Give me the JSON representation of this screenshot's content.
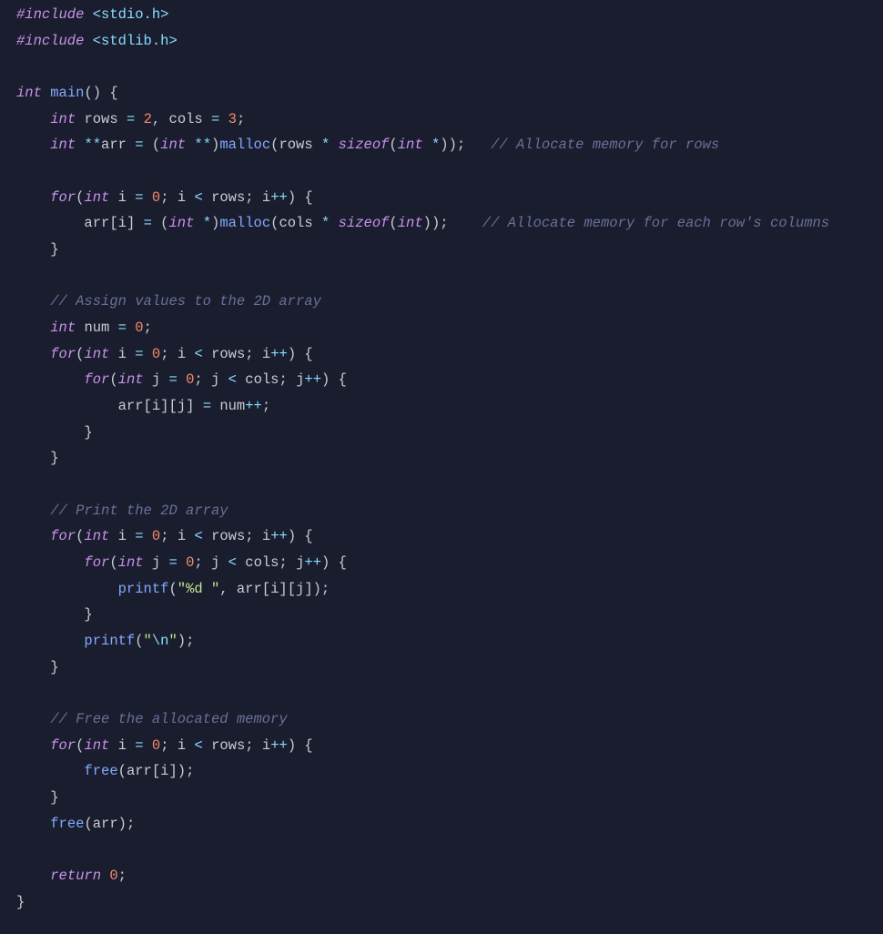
{
  "code": {
    "lines": [
      [
        {
          "c": "inc",
          "t": "#include"
        },
        {
          "c": "pun",
          "t": " "
        },
        {
          "c": "hdr",
          "t": "<stdio.h>"
        }
      ],
      [
        {
          "c": "inc",
          "t": "#include"
        },
        {
          "c": "pun",
          "t": " "
        },
        {
          "c": "hdr",
          "t": "<stdlib.h>"
        }
      ],
      [],
      [
        {
          "c": "type",
          "t": "int"
        },
        {
          "c": "pun",
          "t": " "
        },
        {
          "c": "fn",
          "t": "main"
        },
        {
          "c": "pun",
          "t": "() {"
        }
      ],
      [
        {
          "c": "pun",
          "t": "    "
        },
        {
          "c": "type",
          "t": "int"
        },
        {
          "c": "pun",
          "t": " "
        },
        {
          "c": "id",
          "t": "rows"
        },
        {
          "c": "pun",
          "t": " "
        },
        {
          "c": "op",
          "t": "="
        },
        {
          "c": "pun",
          "t": " "
        },
        {
          "c": "num",
          "t": "2"
        },
        {
          "c": "pun",
          "t": ", "
        },
        {
          "c": "id",
          "t": "cols"
        },
        {
          "c": "pun",
          "t": " "
        },
        {
          "c": "op",
          "t": "="
        },
        {
          "c": "pun",
          "t": " "
        },
        {
          "c": "num",
          "t": "3"
        },
        {
          "c": "pun",
          "t": ";"
        }
      ],
      [
        {
          "c": "pun",
          "t": "    "
        },
        {
          "c": "type",
          "t": "int"
        },
        {
          "c": "pun",
          "t": " "
        },
        {
          "c": "op",
          "t": "**"
        },
        {
          "c": "id",
          "t": "arr"
        },
        {
          "c": "pun",
          "t": " "
        },
        {
          "c": "op",
          "t": "="
        },
        {
          "c": "pun",
          "t": " ("
        },
        {
          "c": "type",
          "t": "int"
        },
        {
          "c": "pun",
          "t": " "
        },
        {
          "c": "op",
          "t": "**"
        },
        {
          "c": "pun",
          "t": ")"
        },
        {
          "c": "call",
          "t": "malloc"
        },
        {
          "c": "pun",
          "t": "("
        },
        {
          "c": "id",
          "t": "rows"
        },
        {
          "c": "pun",
          "t": " "
        },
        {
          "c": "op",
          "t": "*"
        },
        {
          "c": "pun",
          "t": " "
        },
        {
          "c": "kw",
          "t": "sizeof"
        },
        {
          "c": "pun",
          "t": "("
        },
        {
          "c": "type",
          "t": "int"
        },
        {
          "c": "pun",
          "t": " "
        },
        {
          "c": "op",
          "t": "*"
        },
        {
          "c": "pun",
          "t": "));   "
        },
        {
          "c": "cmt",
          "t": "// Allocate memory for rows"
        }
      ],
      [],
      [
        {
          "c": "pun",
          "t": "    "
        },
        {
          "c": "kw",
          "t": "for"
        },
        {
          "c": "pun",
          "t": "("
        },
        {
          "c": "type",
          "t": "int"
        },
        {
          "c": "pun",
          "t": " "
        },
        {
          "c": "id",
          "t": "i"
        },
        {
          "c": "pun",
          "t": " "
        },
        {
          "c": "op",
          "t": "="
        },
        {
          "c": "pun",
          "t": " "
        },
        {
          "c": "num",
          "t": "0"
        },
        {
          "c": "pun",
          "t": "; "
        },
        {
          "c": "id",
          "t": "i"
        },
        {
          "c": "pun",
          "t": " "
        },
        {
          "c": "op",
          "t": "<"
        },
        {
          "c": "pun",
          "t": " "
        },
        {
          "c": "id",
          "t": "rows"
        },
        {
          "c": "pun",
          "t": "; "
        },
        {
          "c": "id",
          "t": "i"
        },
        {
          "c": "op",
          "t": "++"
        },
        {
          "c": "pun",
          "t": ") {"
        }
      ],
      [
        {
          "c": "pun",
          "t": "        "
        },
        {
          "c": "id",
          "t": "arr"
        },
        {
          "c": "pun",
          "t": "["
        },
        {
          "c": "id",
          "t": "i"
        },
        {
          "c": "pun",
          "t": "] "
        },
        {
          "c": "op",
          "t": "="
        },
        {
          "c": "pun",
          "t": " ("
        },
        {
          "c": "type",
          "t": "int"
        },
        {
          "c": "pun",
          "t": " "
        },
        {
          "c": "op",
          "t": "*"
        },
        {
          "c": "pun",
          "t": ")"
        },
        {
          "c": "call",
          "t": "malloc"
        },
        {
          "c": "pun",
          "t": "("
        },
        {
          "c": "id",
          "t": "cols"
        },
        {
          "c": "pun",
          "t": " "
        },
        {
          "c": "op",
          "t": "*"
        },
        {
          "c": "pun",
          "t": " "
        },
        {
          "c": "kw",
          "t": "sizeof"
        },
        {
          "c": "pun",
          "t": "("
        },
        {
          "c": "type",
          "t": "int"
        },
        {
          "c": "pun",
          "t": "));    "
        },
        {
          "c": "cmt",
          "t": "// Allocate memory for each row's columns"
        }
      ],
      [
        {
          "c": "pun",
          "t": "    }"
        }
      ],
      [],
      [
        {
          "c": "pun",
          "t": "    "
        },
        {
          "c": "cmt",
          "t": "// Assign values to the 2D array"
        }
      ],
      [
        {
          "c": "pun",
          "t": "    "
        },
        {
          "c": "type",
          "t": "int"
        },
        {
          "c": "pun",
          "t": " "
        },
        {
          "c": "id",
          "t": "num"
        },
        {
          "c": "pun",
          "t": " "
        },
        {
          "c": "op",
          "t": "="
        },
        {
          "c": "pun",
          "t": " "
        },
        {
          "c": "num",
          "t": "0"
        },
        {
          "c": "pun",
          "t": ";"
        }
      ],
      [
        {
          "c": "pun",
          "t": "    "
        },
        {
          "c": "kw",
          "t": "for"
        },
        {
          "c": "pun",
          "t": "("
        },
        {
          "c": "type",
          "t": "int"
        },
        {
          "c": "pun",
          "t": " "
        },
        {
          "c": "id",
          "t": "i"
        },
        {
          "c": "pun",
          "t": " "
        },
        {
          "c": "op",
          "t": "="
        },
        {
          "c": "pun",
          "t": " "
        },
        {
          "c": "num",
          "t": "0"
        },
        {
          "c": "pun",
          "t": "; "
        },
        {
          "c": "id",
          "t": "i"
        },
        {
          "c": "pun",
          "t": " "
        },
        {
          "c": "op",
          "t": "<"
        },
        {
          "c": "pun",
          "t": " "
        },
        {
          "c": "id",
          "t": "rows"
        },
        {
          "c": "pun",
          "t": "; "
        },
        {
          "c": "id",
          "t": "i"
        },
        {
          "c": "op",
          "t": "++"
        },
        {
          "c": "pun",
          "t": ") {"
        }
      ],
      [
        {
          "c": "pun",
          "t": "        "
        },
        {
          "c": "kw",
          "t": "for"
        },
        {
          "c": "pun",
          "t": "("
        },
        {
          "c": "type",
          "t": "int"
        },
        {
          "c": "pun",
          "t": " "
        },
        {
          "c": "id",
          "t": "j"
        },
        {
          "c": "pun",
          "t": " "
        },
        {
          "c": "op",
          "t": "="
        },
        {
          "c": "pun",
          "t": " "
        },
        {
          "c": "num",
          "t": "0"
        },
        {
          "c": "pun",
          "t": "; "
        },
        {
          "c": "id",
          "t": "j"
        },
        {
          "c": "pun",
          "t": " "
        },
        {
          "c": "op",
          "t": "<"
        },
        {
          "c": "pun",
          "t": " "
        },
        {
          "c": "id",
          "t": "cols"
        },
        {
          "c": "pun",
          "t": "; "
        },
        {
          "c": "id",
          "t": "j"
        },
        {
          "c": "op",
          "t": "++"
        },
        {
          "c": "pun",
          "t": ") {"
        }
      ],
      [
        {
          "c": "pun",
          "t": "            "
        },
        {
          "c": "id",
          "t": "arr"
        },
        {
          "c": "pun",
          "t": "["
        },
        {
          "c": "id",
          "t": "i"
        },
        {
          "c": "pun",
          "t": "]["
        },
        {
          "c": "id",
          "t": "j"
        },
        {
          "c": "pun",
          "t": "] "
        },
        {
          "c": "op",
          "t": "="
        },
        {
          "c": "pun",
          "t": " "
        },
        {
          "c": "id",
          "t": "num"
        },
        {
          "c": "op",
          "t": "++"
        },
        {
          "c": "pun",
          "t": ";"
        }
      ],
      [
        {
          "c": "pun",
          "t": "        }"
        }
      ],
      [
        {
          "c": "pun",
          "t": "    }"
        }
      ],
      [],
      [
        {
          "c": "pun",
          "t": "    "
        },
        {
          "c": "cmt",
          "t": "// Print the 2D array"
        }
      ],
      [
        {
          "c": "pun",
          "t": "    "
        },
        {
          "c": "kw",
          "t": "for"
        },
        {
          "c": "pun",
          "t": "("
        },
        {
          "c": "type",
          "t": "int"
        },
        {
          "c": "pun",
          "t": " "
        },
        {
          "c": "id",
          "t": "i"
        },
        {
          "c": "pun",
          "t": " "
        },
        {
          "c": "op",
          "t": "="
        },
        {
          "c": "pun",
          "t": " "
        },
        {
          "c": "num",
          "t": "0"
        },
        {
          "c": "pun",
          "t": "; "
        },
        {
          "c": "id",
          "t": "i"
        },
        {
          "c": "pun",
          "t": " "
        },
        {
          "c": "op",
          "t": "<"
        },
        {
          "c": "pun",
          "t": " "
        },
        {
          "c": "id",
          "t": "rows"
        },
        {
          "c": "pun",
          "t": "; "
        },
        {
          "c": "id",
          "t": "i"
        },
        {
          "c": "op",
          "t": "++"
        },
        {
          "c": "pun",
          "t": ") {"
        }
      ],
      [
        {
          "c": "pun",
          "t": "        "
        },
        {
          "c": "kw",
          "t": "for"
        },
        {
          "c": "pun",
          "t": "("
        },
        {
          "c": "type",
          "t": "int"
        },
        {
          "c": "pun",
          "t": " "
        },
        {
          "c": "id",
          "t": "j"
        },
        {
          "c": "pun",
          "t": " "
        },
        {
          "c": "op",
          "t": "="
        },
        {
          "c": "pun",
          "t": " "
        },
        {
          "c": "num",
          "t": "0"
        },
        {
          "c": "pun",
          "t": "; "
        },
        {
          "c": "id",
          "t": "j"
        },
        {
          "c": "pun",
          "t": " "
        },
        {
          "c": "op",
          "t": "<"
        },
        {
          "c": "pun",
          "t": " "
        },
        {
          "c": "id",
          "t": "cols"
        },
        {
          "c": "pun",
          "t": "; "
        },
        {
          "c": "id",
          "t": "j"
        },
        {
          "c": "op",
          "t": "++"
        },
        {
          "c": "pun",
          "t": ") {"
        }
      ],
      [
        {
          "c": "pun",
          "t": "            "
        },
        {
          "c": "call",
          "t": "printf"
        },
        {
          "c": "pun",
          "t": "("
        },
        {
          "c": "str",
          "t": "\"%d \""
        },
        {
          "c": "pun",
          "t": ", "
        },
        {
          "c": "id",
          "t": "arr"
        },
        {
          "c": "pun",
          "t": "["
        },
        {
          "c": "id",
          "t": "i"
        },
        {
          "c": "pun",
          "t": "]["
        },
        {
          "c": "id",
          "t": "j"
        },
        {
          "c": "pun",
          "t": "]);"
        }
      ],
      [
        {
          "c": "pun",
          "t": "        }"
        }
      ],
      [
        {
          "c": "pun",
          "t": "        "
        },
        {
          "c": "call",
          "t": "printf"
        },
        {
          "c": "pun",
          "t": "("
        },
        {
          "c": "str",
          "t": "\""
        },
        {
          "c": "esc",
          "t": "\\n"
        },
        {
          "c": "str",
          "t": "\""
        },
        {
          "c": "pun",
          "t": ");"
        }
      ],
      [
        {
          "c": "pun",
          "t": "    }"
        }
      ],
      [],
      [
        {
          "c": "pun",
          "t": "    "
        },
        {
          "c": "cmt",
          "t": "// Free the allocated memory"
        }
      ],
      [
        {
          "c": "pun",
          "t": "    "
        },
        {
          "c": "kw",
          "t": "for"
        },
        {
          "c": "pun",
          "t": "("
        },
        {
          "c": "type",
          "t": "int"
        },
        {
          "c": "pun",
          "t": " "
        },
        {
          "c": "id",
          "t": "i"
        },
        {
          "c": "pun",
          "t": " "
        },
        {
          "c": "op",
          "t": "="
        },
        {
          "c": "pun",
          "t": " "
        },
        {
          "c": "num",
          "t": "0"
        },
        {
          "c": "pun",
          "t": "; "
        },
        {
          "c": "id",
          "t": "i"
        },
        {
          "c": "pun",
          "t": " "
        },
        {
          "c": "op",
          "t": "<"
        },
        {
          "c": "pun",
          "t": " "
        },
        {
          "c": "id",
          "t": "rows"
        },
        {
          "c": "pun",
          "t": "; "
        },
        {
          "c": "id",
          "t": "i"
        },
        {
          "c": "op",
          "t": "++"
        },
        {
          "c": "pun",
          "t": ") {"
        }
      ],
      [
        {
          "c": "pun",
          "t": "        "
        },
        {
          "c": "call",
          "t": "free"
        },
        {
          "c": "pun",
          "t": "("
        },
        {
          "c": "id",
          "t": "arr"
        },
        {
          "c": "pun",
          "t": "["
        },
        {
          "c": "id",
          "t": "i"
        },
        {
          "c": "pun",
          "t": "]);"
        }
      ],
      [
        {
          "c": "pun",
          "t": "    }"
        }
      ],
      [
        {
          "c": "pun",
          "t": "    "
        },
        {
          "c": "call",
          "t": "free"
        },
        {
          "c": "pun",
          "t": "("
        },
        {
          "c": "id",
          "t": "arr"
        },
        {
          "c": "pun",
          "t": ");"
        }
      ],
      [],
      [
        {
          "c": "pun",
          "t": "    "
        },
        {
          "c": "kw",
          "t": "return"
        },
        {
          "c": "pun",
          "t": " "
        },
        {
          "c": "num",
          "t": "0"
        },
        {
          "c": "pun",
          "t": ";"
        }
      ],
      [
        {
          "c": "pun",
          "t": "}"
        }
      ]
    ]
  }
}
